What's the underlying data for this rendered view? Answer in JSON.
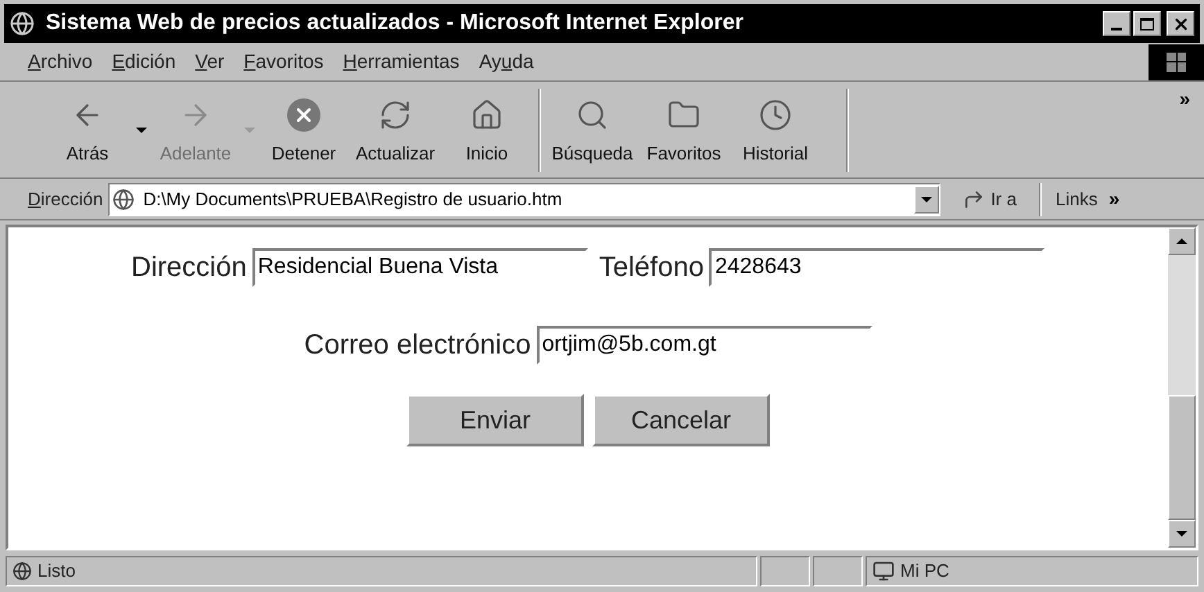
{
  "window": {
    "title": "Sistema Web de precios actualizados - Microsoft Internet Explorer"
  },
  "menu": [
    {
      "key": "A",
      "after": "rchivo"
    },
    {
      "key": "E",
      "after": "dición"
    },
    {
      "key": "V",
      "after": "er"
    },
    {
      "key": "F",
      "after": "avoritos"
    },
    {
      "key": "H",
      "after": "erramientas"
    },
    {
      "before": "Ay",
      "key": "u",
      "after": "da"
    }
  ],
  "toolbar": [
    {
      "kind": "back",
      "label": "Atrás",
      "disabled": false,
      "dropdown": true
    },
    {
      "kind": "forward",
      "label": "Adelante",
      "disabled": true,
      "dropdown": true
    },
    {
      "kind": "stop",
      "label": "Detener",
      "disabled": false,
      "dropdown": false
    },
    {
      "kind": "refresh",
      "label": "Actualizar",
      "disabled": false,
      "dropdown": false
    },
    {
      "kind": "home",
      "label": "Inicio",
      "disabled": false,
      "dropdown": false
    },
    {
      "kind": "search",
      "label": "Búsqueda",
      "disabled": false,
      "dropdown": false,
      "separator": true
    },
    {
      "kind": "favorites",
      "label": "Favoritos",
      "disabled": false,
      "dropdown": false
    },
    {
      "kind": "history",
      "label": "Historial",
      "disabled": false,
      "dropdown": false
    }
  ],
  "toolbar_more": "»",
  "address": {
    "label": {
      "key": "D",
      "after": "irección"
    },
    "value": "D:\\My Documents\\PRUEBA\\Registro de usuario.htm",
    "go": "Ir a",
    "links": "Links",
    "links_more": "»"
  },
  "form": {
    "rows": [
      [
        {
          "label": "Dirección",
          "value": "Residencial Buena Vista"
        },
        {
          "label": "Teléfono",
          "value": "2428643"
        }
      ],
      [
        {
          "label": "Correo electrónico",
          "value": "ortjim@5b.com.gt"
        }
      ]
    ],
    "buttons": [
      "Enviar",
      "Cancelar"
    ]
  },
  "status_bar": {
    "text": "Listo",
    "zone": "Mi PC"
  }
}
